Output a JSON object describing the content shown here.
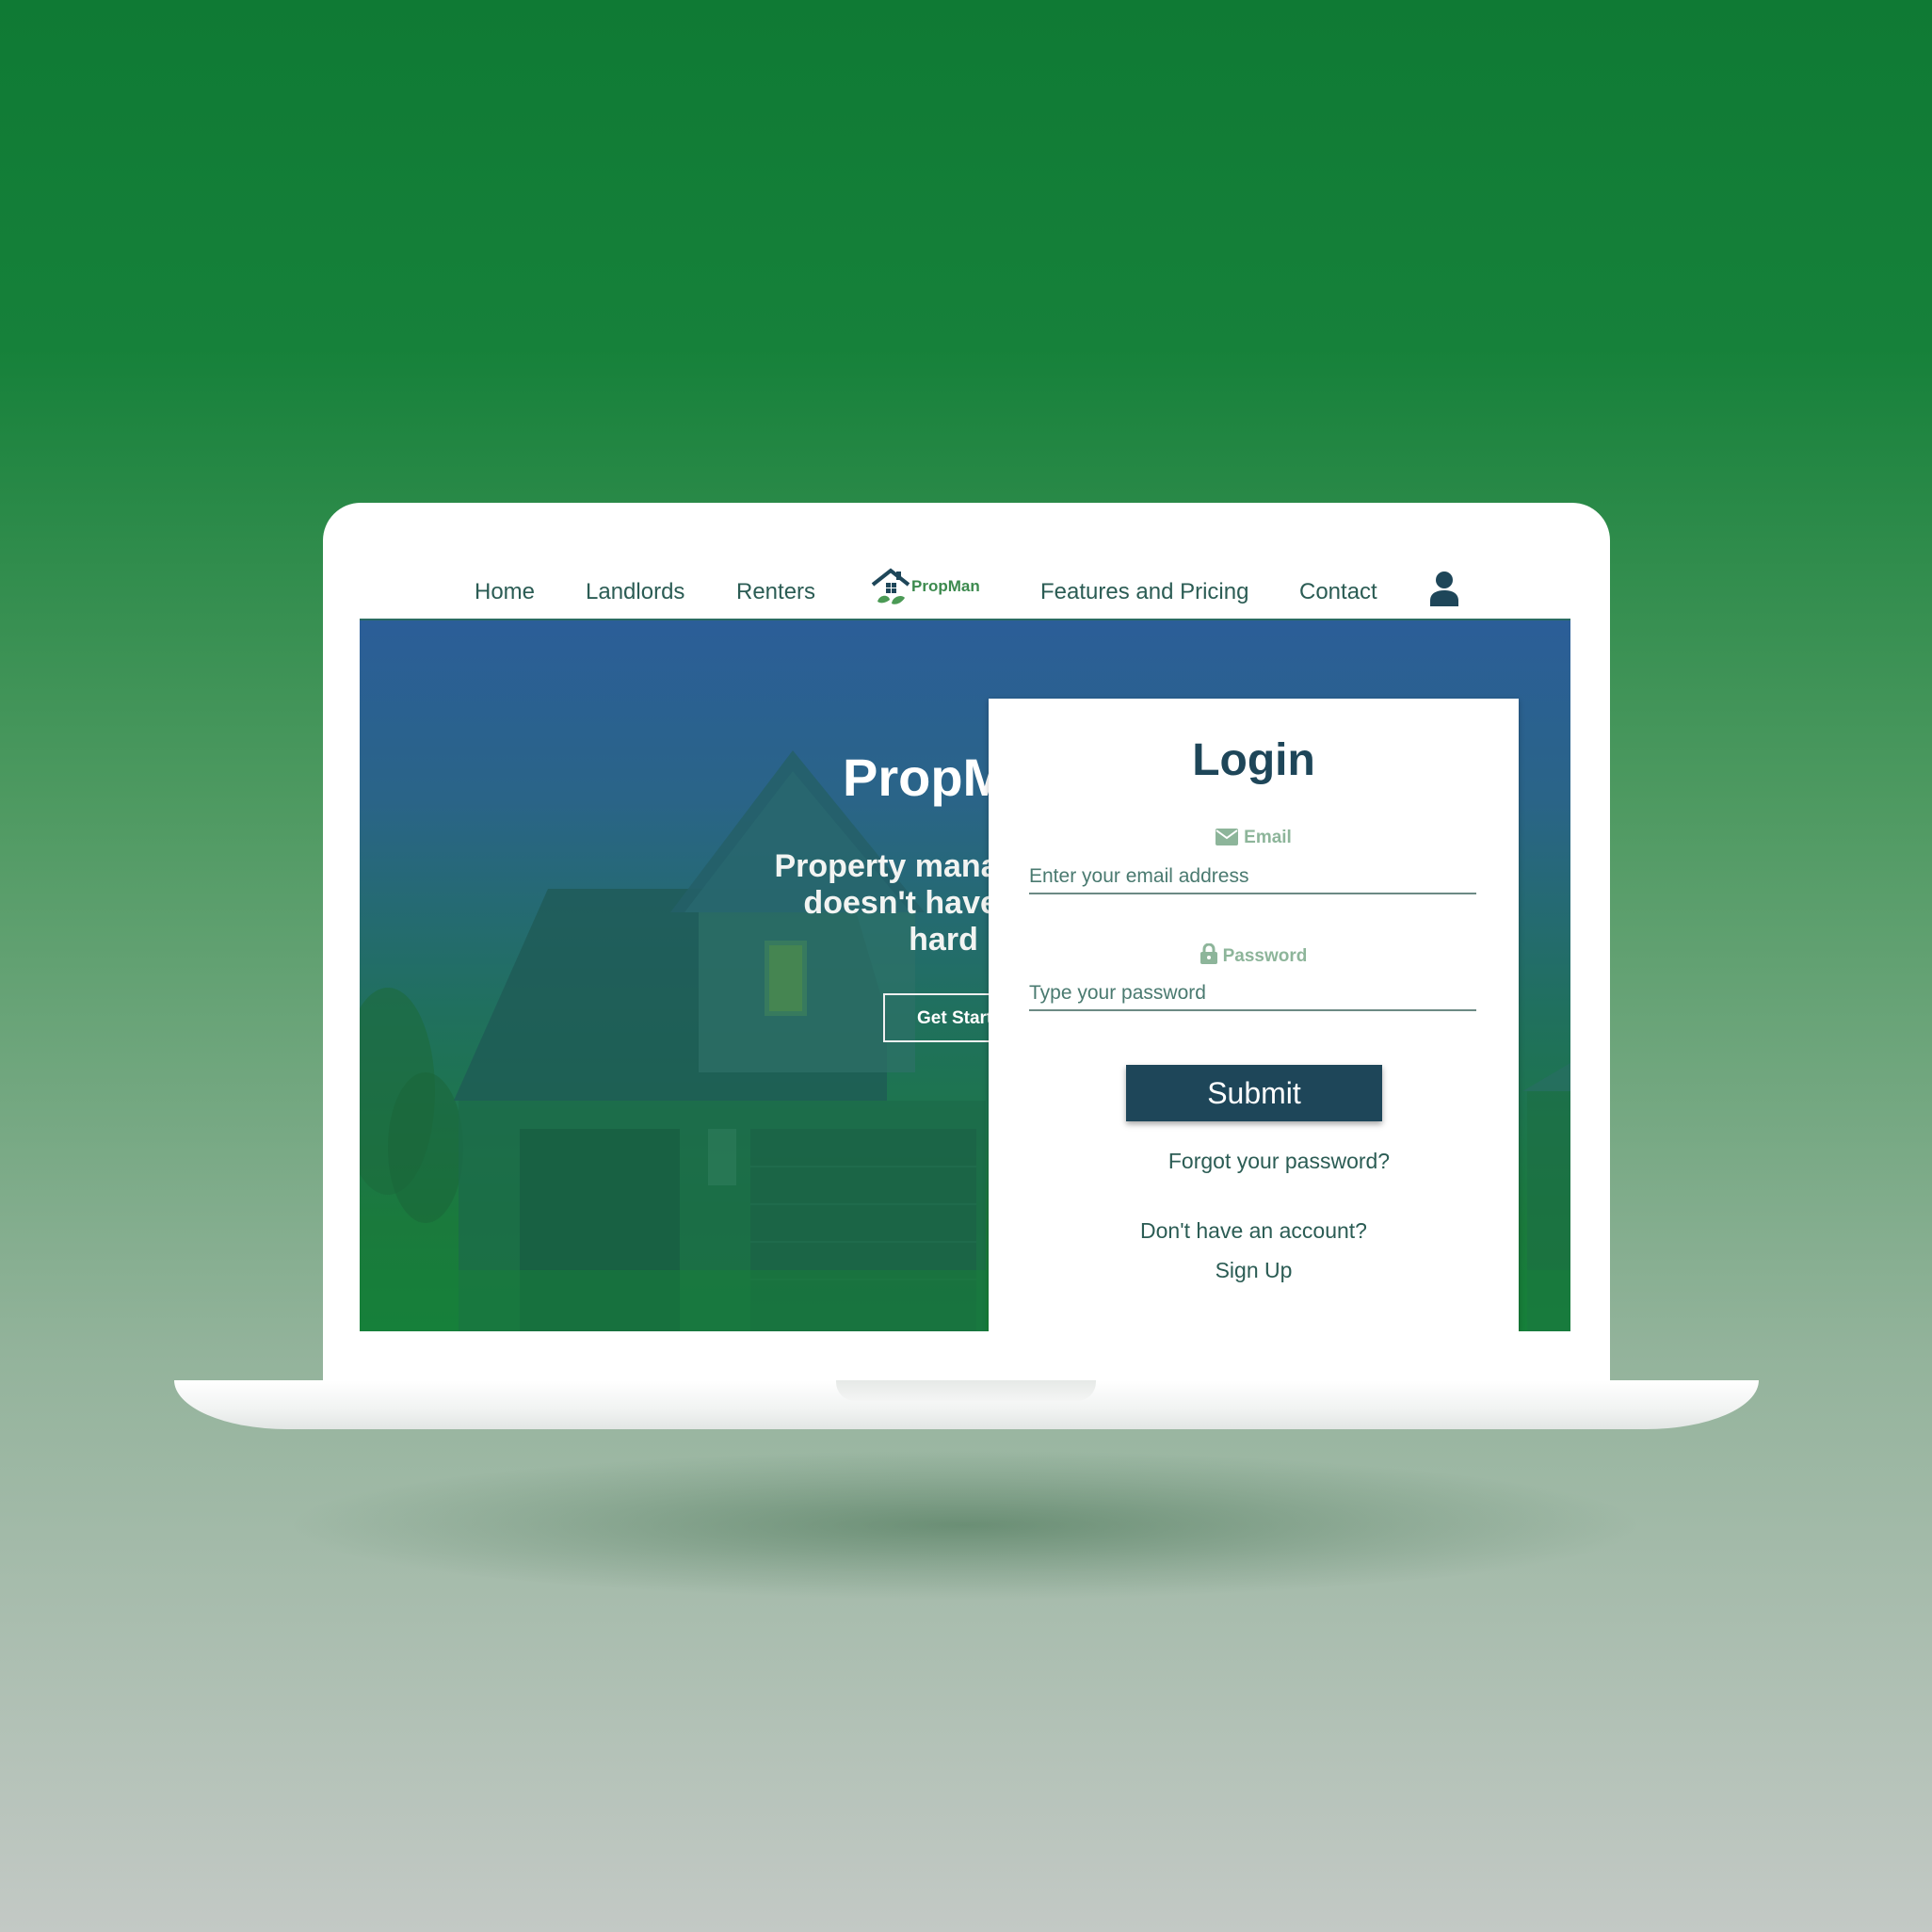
{
  "nav": {
    "items": [
      "Home",
      "Landlords",
      "Renters",
      "Features and Pricing",
      "Contact"
    ],
    "logo_text": "PropMan"
  },
  "hero": {
    "title": "PropMan",
    "subtitle_lines": [
      "Property management",
      "doesn't have to be",
      "hard"
    ],
    "cta_label": "Get Started"
  },
  "login": {
    "title": "Login",
    "email_label": "Email",
    "email_placeholder": "Enter your email address",
    "password_label": "Password",
    "password_placeholder": "Type your password",
    "submit_label": "Submit",
    "forgot_label": "Forgot your password?",
    "no_account_text": "Don't have an account?",
    "signup_label": "Sign Up"
  },
  "colors": {
    "primary": "#1e4659",
    "accent_green": "#3c8a4e",
    "hero_top": "#2b5e98",
    "hero_bottom": "#16803a"
  },
  "icons": [
    "home-leaf-logo-icon",
    "user-icon",
    "envelope-icon",
    "lock-icon"
  ]
}
